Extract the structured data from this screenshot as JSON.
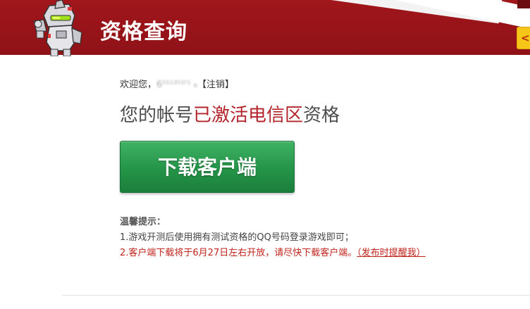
{
  "header": {
    "title": "资格查询",
    "background_color": "#a0161b",
    "mascot_icon": "robot-mascot-icon"
  },
  "side_tab": {
    "icon": "chevron-left-icon",
    "glyph": "<",
    "color": "#f5c518"
  },
  "account": {
    "welcome_prefix": "欢迎您，",
    "username": "6⁰¹¹³⁵¹ᶠ¹ ₆",
    "logout": "【注销】"
  },
  "status": {
    "prefix": "您的帐号",
    "highlight": "已激活电信区",
    "suffix": "资格",
    "highlight_color": "#b3232a"
  },
  "download": {
    "label": "下载客户端",
    "color": "#249548"
  },
  "tips": {
    "title": "温馨提示：",
    "items": [
      {
        "text": "1.游戏开测后使用拥有测试资格的QQ号码登录游戏即可；"
      },
      {
        "text": "2.客户端下载将于6月27日左右开放，请尽快下载客户端。",
        "link": "（发布时提醒我）",
        "color": "#c0231c"
      }
    ]
  }
}
